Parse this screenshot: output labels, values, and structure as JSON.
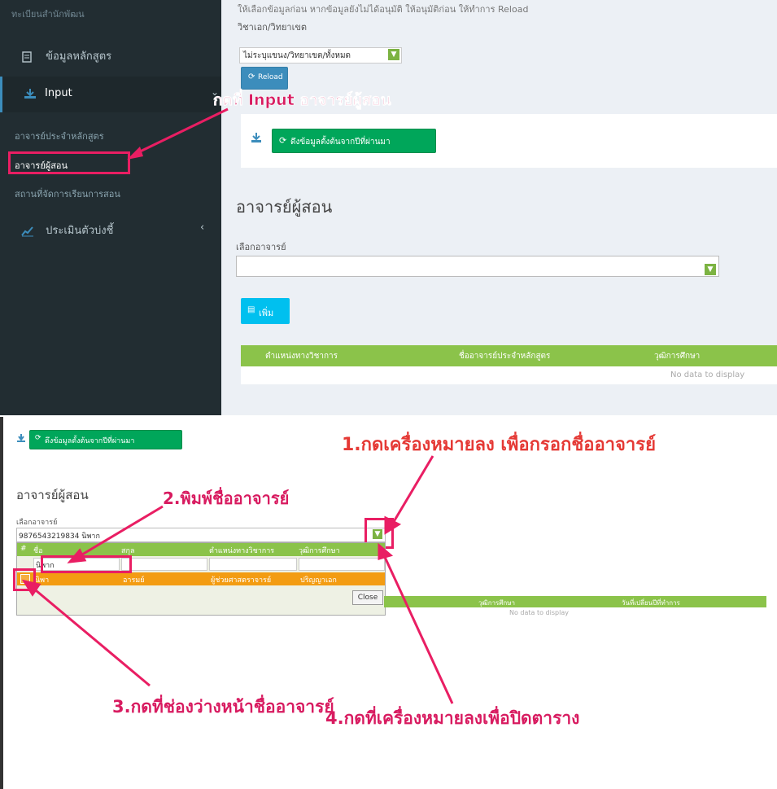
{
  "top": {
    "sidebar": {
      "breadcrumb": "ทะเบียนสำนักพัฒน",
      "items": [
        {
          "label": "ข้อมูลหลักสูตร"
        },
        {
          "label": "Input"
        },
        {
          "label": "ประเมินตัวบ่งชี้"
        }
      ],
      "subitems": [
        {
          "label": "อาจารย์ประจำหลักสูตร"
        },
        {
          "label": "อาจารย์ผู้สอน"
        },
        {
          "label": "สถานที่จัดการเรียนการสอน"
        }
      ]
    },
    "main": {
      "header_text": "ให้เลือกข้อมูลก่อน หากข้อมูลยังไม่ได้อนุมัติ ให้อนุมัติก่อน ให้ทำการ Reload",
      "subheader": "วิชาเอก/วิทยาเขต",
      "campus_select": "ไม่ระบุแขนง/วิทยาเขต/ทั้งหมด",
      "reload_label": "Reload",
      "pull_data_label": "ดึงข้อมูลตั้งต้นจากปีที่ผ่านมา",
      "section_title": "อาจารย์ผู้สอน",
      "select_label": "เลือกอาจารย์",
      "add_label": "เพิ่ม",
      "grid_columns": [
        "ตำแหน่งทางวิชาการ",
        "ชื่ออาจารย์ประจำหลักสูตร",
        "วุฒิการศึกษา"
      ],
      "grid_empty": "No data to display"
    },
    "annotation": "กดที่ Input อาจารย์ผู้สอน"
  },
  "bottom": {
    "pull_data_label": "ดึงข้อมูลตั้งต้นจากปีที่ผ่านมา",
    "section_title": "อาจารย์ผู้สอน",
    "select_label": "เลือกอาจารย์",
    "select_value": "9876543219834 นิพาก",
    "popup": {
      "columns": [
        "#",
        "ชื่อ",
        "สกุล",
        "ตำแหน่งทางวิชาการ",
        "วุฒิการศึกษา"
      ],
      "filter_value": "นิพาก",
      "row": [
        "",
        "นิพา",
        "อารมย์",
        "ผู้ช่วยศาสตราจารย์",
        "ปริญญาเอก"
      ],
      "close_label": "Close"
    },
    "grid_columns": [
      "วุฒิการศึกษา",
      "วันที่เปลี่ยนปีที่ทำการ"
    ],
    "grid_empty": "No data to display",
    "annotations": {
      "step1": "1.กดเครื่องหมายลง เพื่อกรอกชื่ออาจารย์",
      "step2": "2.พิมพ์ชื่ออาจารย์",
      "step3": "3.กดที่ช่องว่างหน้าชื่ออาจารย์",
      "step4": "4.กดที่เครื่องหมายลงเพื่อปิดตาราง"
    }
  },
  "colors": {
    "sidebar_bg": "#222d32",
    "green": "#00a65a",
    "grid_green": "#8bc34a",
    "orange_row": "#f39c12",
    "annotation_pink": "#d81b60",
    "annotation_red": "#e53935",
    "highlight_box": "#e91e63"
  }
}
